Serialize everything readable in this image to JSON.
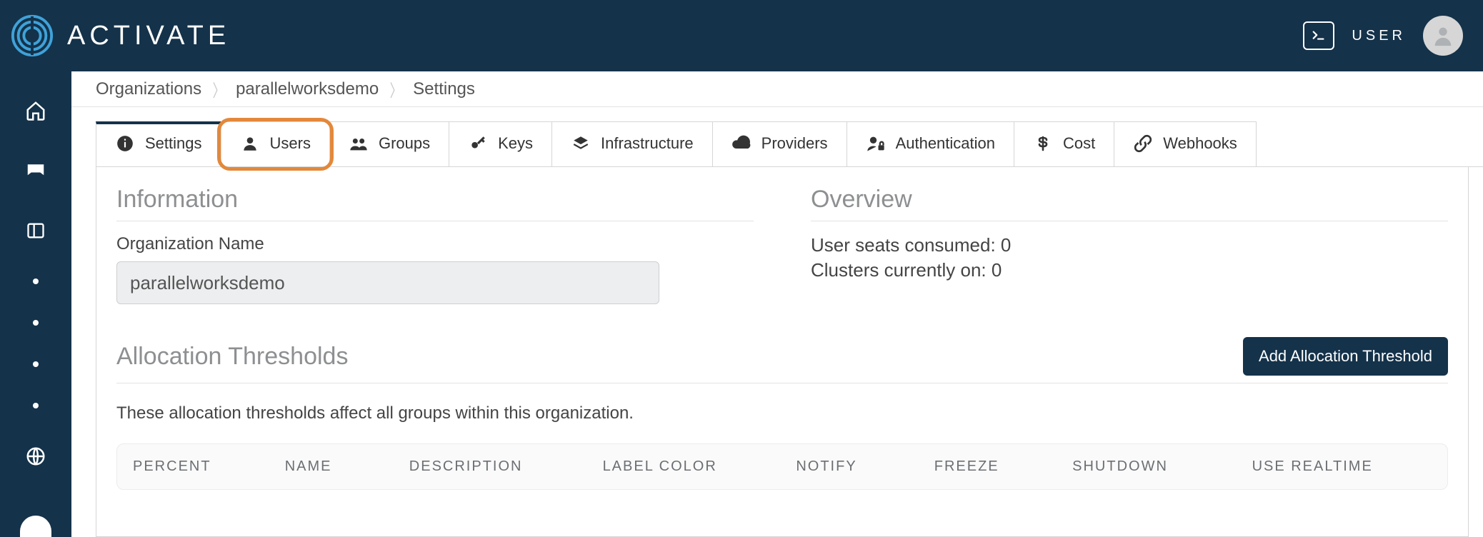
{
  "brand": {
    "name": "ACTIVATE"
  },
  "topbar": {
    "user_label": "USER"
  },
  "breadcrumbs": {
    "items": [
      "Organizations",
      "parallelworksdemo",
      "Settings"
    ]
  },
  "tabs": {
    "items": [
      {
        "label": "Settings"
      },
      {
        "label": "Users"
      },
      {
        "label": "Groups"
      },
      {
        "label": "Keys"
      },
      {
        "label": "Infrastructure"
      },
      {
        "label": "Providers"
      },
      {
        "label": "Authentication"
      },
      {
        "label": "Cost"
      },
      {
        "label": "Webhooks"
      }
    ]
  },
  "info": {
    "heading": "Information",
    "org_name_label": "Organization Name",
    "org_name_value": "parallelworksdemo"
  },
  "overview": {
    "heading": "Overview",
    "seats_label": "User seats consumed:",
    "seats_value": "0",
    "clusters_label": "Clusters currently on:",
    "clusters_value": "0"
  },
  "alloc": {
    "heading": "Allocation Thresholds",
    "add_button": "Add Allocation Threshold",
    "description": "These allocation thresholds affect all groups within this organization.",
    "columns": [
      "PERCENT",
      "NAME",
      "DESCRIPTION",
      "LABEL COLOR",
      "NOTIFY",
      "FREEZE",
      "SHUTDOWN",
      "USE REALTIME"
    ]
  }
}
